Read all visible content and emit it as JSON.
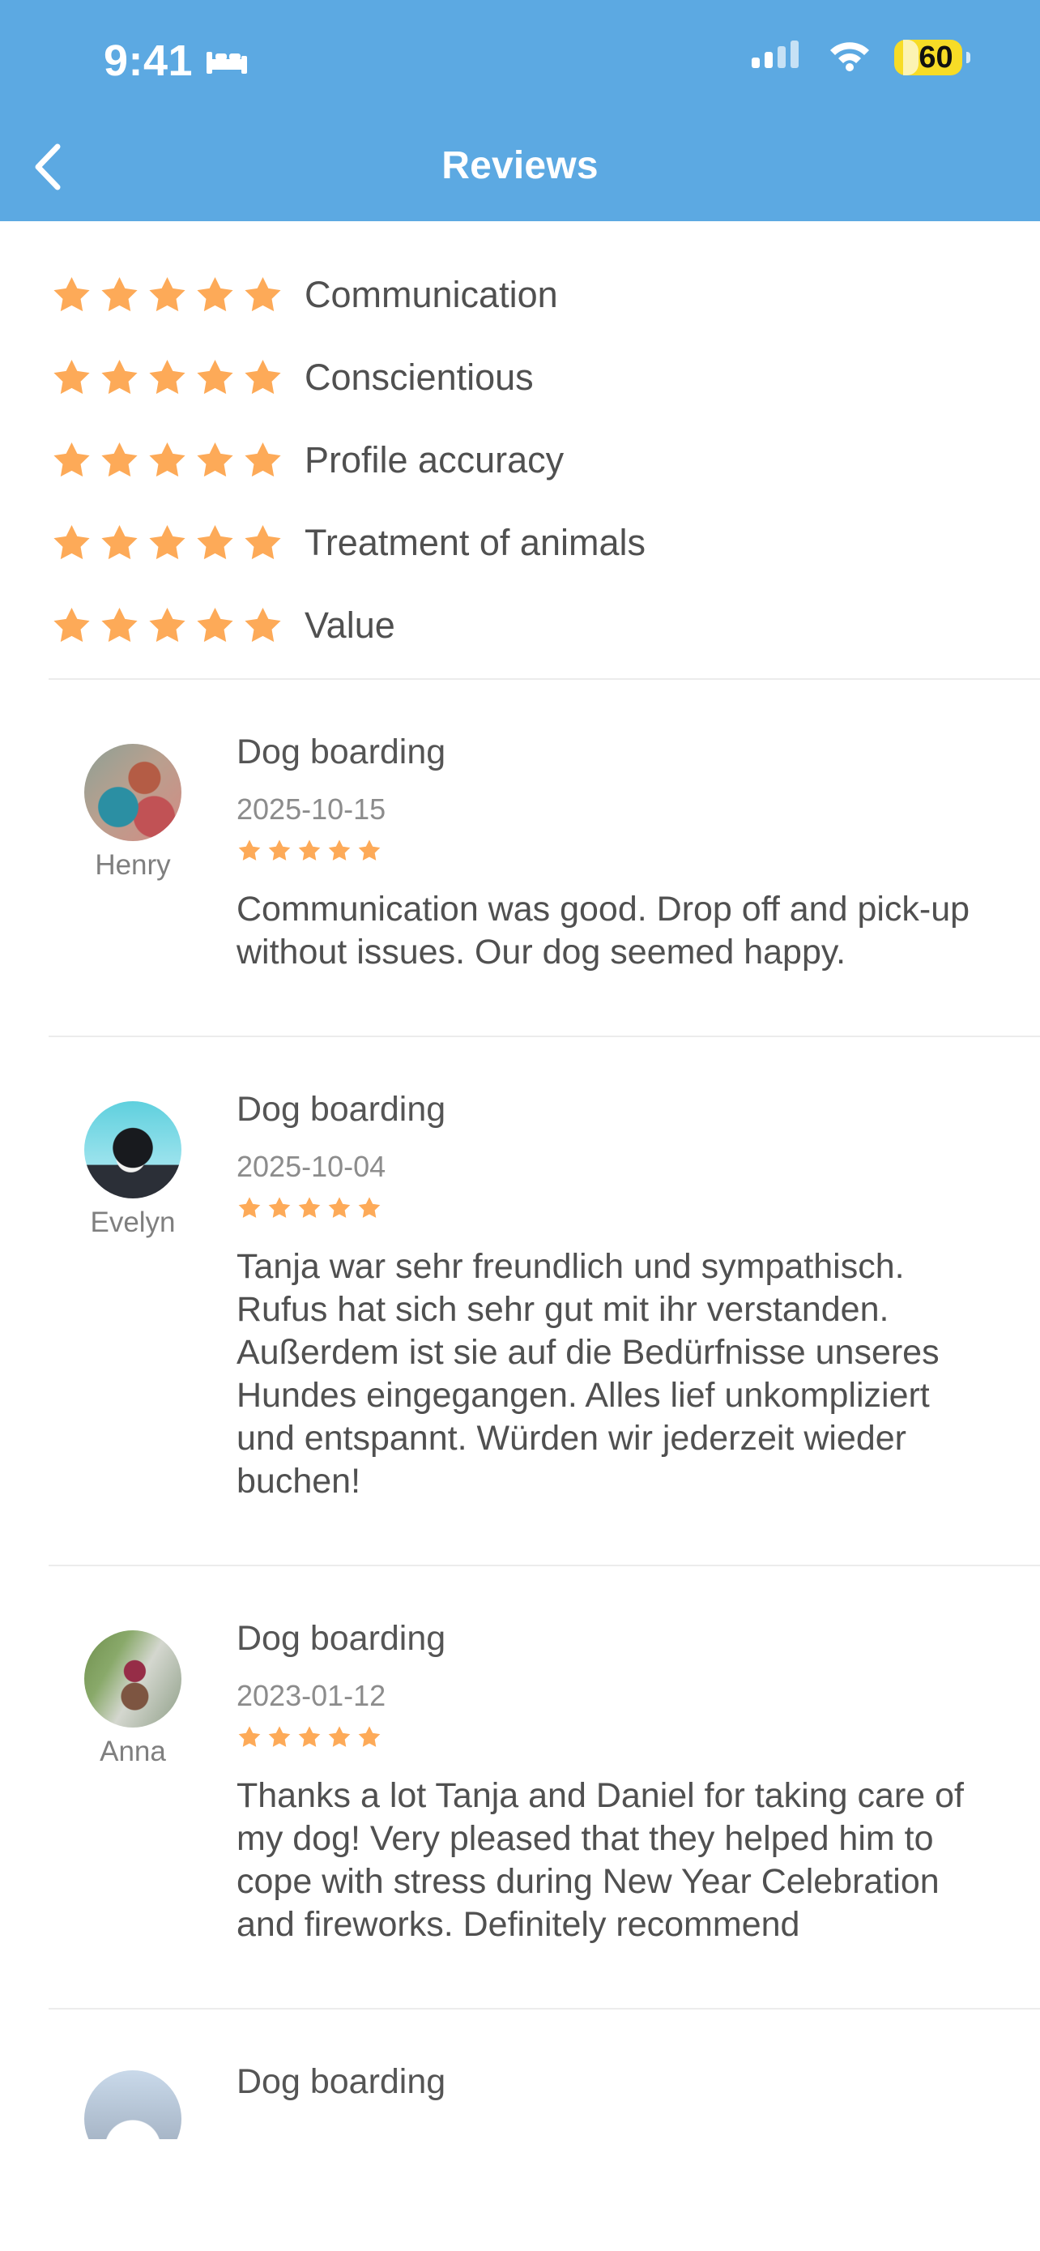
{
  "status": {
    "time": "9:41",
    "battery": "60",
    "battery_level": 0.6,
    "icons": [
      "bed-icon",
      "signal-icon",
      "wifi-icon",
      "battery-icon"
    ]
  },
  "header": {
    "title": "Reviews",
    "back_icon": "chevron-left-icon",
    "background": "#5ca9e2"
  },
  "summary": {
    "star_color": "#fdaa58",
    "ratings": [
      {
        "label": "Communication",
        "stars": 5
      },
      {
        "label": "Conscientious",
        "stars": 5
      },
      {
        "label": "Profile accuracy",
        "stars": 5
      },
      {
        "label": "Treatment of animals",
        "stars": 5
      },
      {
        "label": "Value",
        "stars": 5
      }
    ]
  },
  "reviews": [
    {
      "reviewer": "Henry",
      "service": "Dog boarding",
      "date": "2025-10-15",
      "stars": 5,
      "text": "Communication was good. Drop off and pick-up without issues. Our dog seemed happy."
    },
    {
      "reviewer": "Evelyn",
      "service": "Dog boarding",
      "date": "2025-10-04",
      "stars": 5,
      "text": "Tanja war sehr freundlich und sympathisch. Rufus hat sich sehr gut mit ihr verstanden. Außerdem ist sie auf die Bedürfnisse unseres Hundes eingegangen. Alles lief unkompliziert und entspannt. Würden wir jederzeit wieder buchen!"
    },
    {
      "reviewer": "Anna",
      "service": "Dog boarding",
      "date": "2023-01-12",
      "stars": 5,
      "text": "Thanks a lot Tanja and Daniel for taking care of my dog! Very pleased that they helped him to cope with stress during New Year Celebration and fireworks. Definitely recommend"
    },
    {
      "service": "Dog boarding"
    }
  ]
}
